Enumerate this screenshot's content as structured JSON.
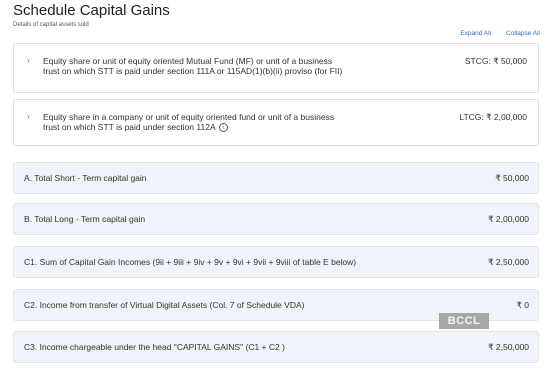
{
  "header": {
    "title": "Schedule Capital Gains",
    "subtitle": "Details of capital assets sold"
  },
  "toolbar": {
    "expand_all": "Expand All",
    "collapse_all": "Collapse All"
  },
  "accordions": [
    {
      "text": "Equity share or unit of equity oriented Mutual Fund (MF) or unit of a business trust on which STT is paid under section 111A or 115AD(1)(b)(ii) proviso (for FII)",
      "value": "STCG: ₹ 50,000"
    },
    {
      "text": "Equity share in a company or unit of equity oriented fund or unit of a business trust on which STT is paid under section 112A",
      "value": "LTCG: ₹ 2,00,000"
    }
  ],
  "summary": [
    {
      "label": "A. Total Short - Term capital gain",
      "amount": "₹ 50,000"
    },
    {
      "label": "B. Total Long - Term capital gain",
      "amount": "₹ 2,00,000"
    },
    {
      "label": "C1. Sum of Capital Gain Incomes (9ii + 9iii + 9iv + 9v + 9vi + 9vii + 9viii of table E below)",
      "amount": "₹ 2,50,000"
    },
    {
      "label": "C2. Income from transfer of Virtual Digital Assets (Col. 7 of Schedule VDA)",
      "amount": "₹ 0"
    },
    {
      "label": "C3. Income chargeable under the head \"CAPITAL GAINS\" (C1 + C2 )",
      "amount": "₹ 2,50,000"
    }
  ],
  "watermark": "BCCL",
  "icons": {
    "chevron": "chevron-right-icon",
    "info": "info-icon"
  }
}
